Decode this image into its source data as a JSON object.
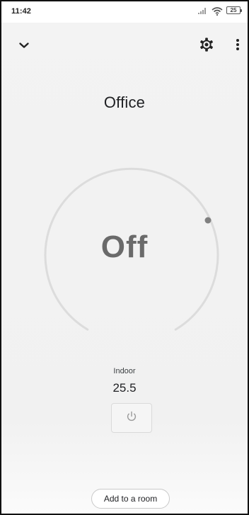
{
  "status_bar": {
    "time": "11:42",
    "battery": "25",
    "icons": [
      "signal-icon",
      "wifi-icon",
      "battery-icon"
    ]
  },
  "toolbar": {
    "back_icon": "chevron-down-icon",
    "settings_icon": "gear-icon",
    "more_icon": "more-vert-icon"
  },
  "device": {
    "name": "Office",
    "mode": "Off"
  },
  "indoor": {
    "label": "Indoor",
    "value": "25.5"
  },
  "power_icon": "power-icon",
  "add_room_label": "Add to a room",
  "colors": {
    "background": "#f2f2f2",
    "dial_track": "#dcdcdc",
    "dial_knob": "#808080",
    "mode_text": "#6a6a6a"
  }
}
